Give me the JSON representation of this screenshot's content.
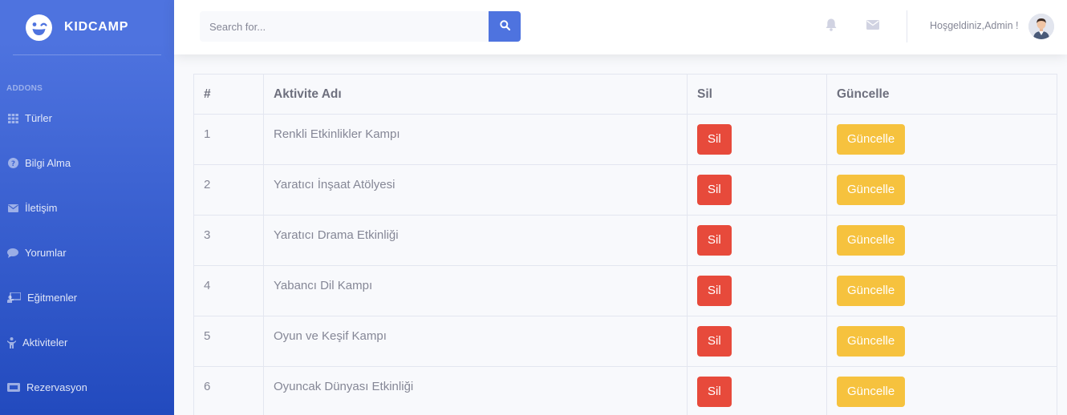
{
  "brand": {
    "name": "KIDCAMP"
  },
  "sidebar": {
    "heading": "ADDONS",
    "items": [
      {
        "label": "Türler",
        "icon": "grid-icon"
      },
      {
        "label": "Bilgi Alma",
        "icon": "question-circle-icon"
      },
      {
        "label": "İletişim",
        "icon": "envelope-icon"
      },
      {
        "label": "Yorumlar",
        "icon": "comment-icon"
      },
      {
        "label": "Eğitmenler",
        "icon": "chalkboard-teacher-icon"
      },
      {
        "label": "Aktiviteler",
        "icon": "child-icon"
      },
      {
        "label": "Rezervasyon",
        "icon": "ticket-icon"
      }
    ]
  },
  "topbar": {
    "search_placeholder": "Search for...",
    "user_greeting": "Hoşgeldiniz,Admin !"
  },
  "table": {
    "headers": [
      "#",
      "Aktivite Adı",
      "Sil",
      "Güncelle"
    ],
    "rows": [
      {
        "num": "1",
        "name": "Renkli Etkinlikler Kampı",
        "delete": "Sil",
        "update": "Güncelle"
      },
      {
        "num": "2",
        "name": "Yaratıcı İnşaat Atölyesi",
        "delete": "Sil",
        "update": "Güncelle"
      },
      {
        "num": "3",
        "name": "Yaratıcı Drama Etkinliği",
        "delete": "Sil",
        "update": "Güncelle"
      },
      {
        "num": "4",
        "name": "Yabancı Dil Kampı",
        "delete": "Sil",
        "update": "Güncelle"
      },
      {
        "num": "5",
        "name": "Oyun ve Keşif Kampı",
        "delete": "Sil",
        "update": "Güncelle"
      },
      {
        "num": "6",
        "name": "Oyuncak Dünyası Etkinliği",
        "delete": "Sil",
        "update": "Güncelle"
      }
    ]
  },
  "colors": {
    "primary": "#4e73df",
    "danger": "#e74a3b",
    "warning": "#f6c23e"
  }
}
